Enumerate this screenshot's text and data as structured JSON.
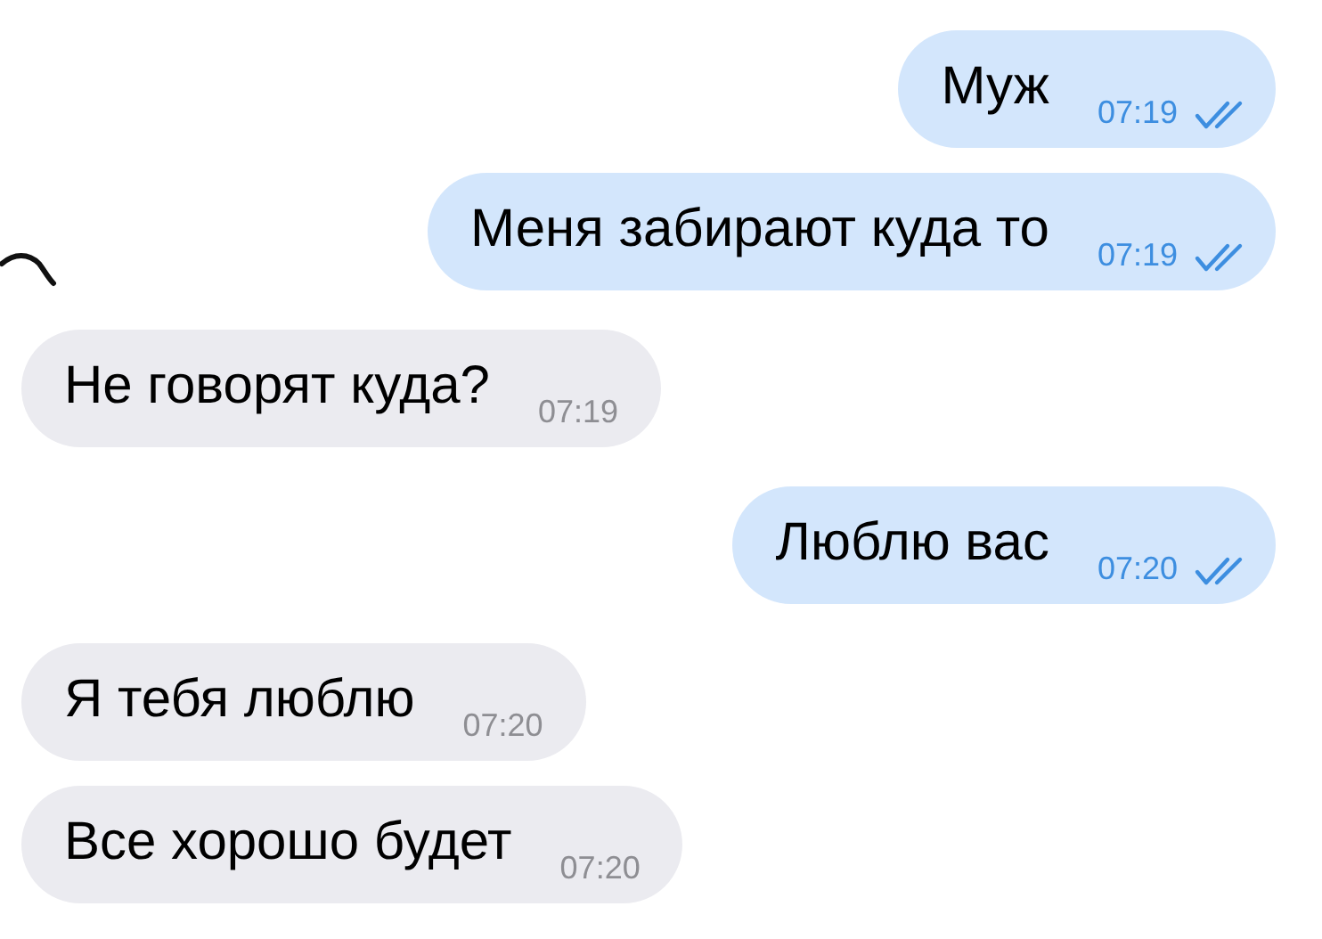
{
  "messages": [
    {
      "text": "Муж",
      "time": "07:19",
      "outgoing": true,
      "read": true
    },
    {
      "text": "Меня забирают куда то",
      "time": "07:19",
      "outgoing": true,
      "read": true
    },
    {
      "text": "Не говорят куда?",
      "time": "07:19",
      "outgoing": false
    },
    {
      "text": "Люблю вас",
      "time": "07:20",
      "outgoing": true,
      "read": true
    },
    {
      "text": "Я тебя люблю",
      "time": "07:20",
      "outgoing": false
    },
    {
      "text": "Все хорошо будет",
      "time": "07:20",
      "outgoing": false
    }
  ]
}
